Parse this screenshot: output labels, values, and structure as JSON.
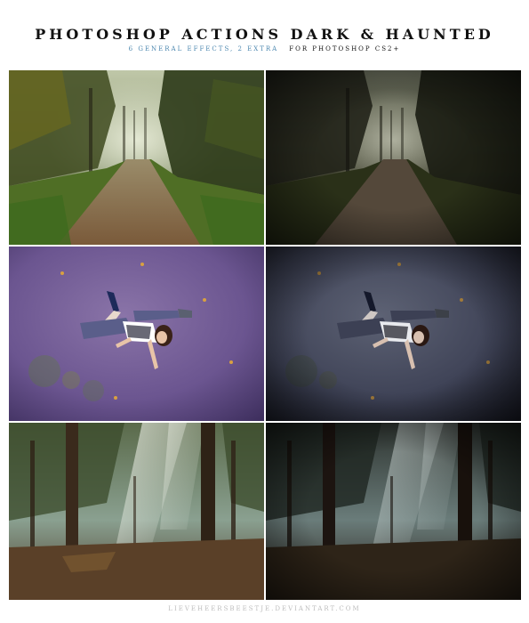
{
  "header": {
    "title": "PHOTOSHOP ACTIONS DARK & HAUNTED",
    "subtitle_effects": "6 GENERAL EFFECTS, 2 EXTRA",
    "subtitle_version": "FOR PHOTOSHOP CS2+"
  },
  "panels": [
    {
      "row": 1,
      "side": "original",
      "subject": "forest-path"
    },
    {
      "row": 1,
      "side": "effect",
      "subject": "forest-path"
    },
    {
      "row": 2,
      "side": "original",
      "subject": "girl-lying-on-ground"
    },
    {
      "row": 2,
      "side": "effect",
      "subject": "girl-lying-on-ground"
    },
    {
      "row": 3,
      "side": "original",
      "subject": "sunlit-forest"
    },
    {
      "row": 3,
      "side": "effect",
      "subject": "sunlit-forest"
    }
  ],
  "colors": {
    "accent": "#4d88b0",
    "title": "#111111",
    "footer": "#bdbdbd"
  },
  "footer": {
    "credit": "LIEVEHEERSBEESTJE.DEVIANTART.COM"
  }
}
